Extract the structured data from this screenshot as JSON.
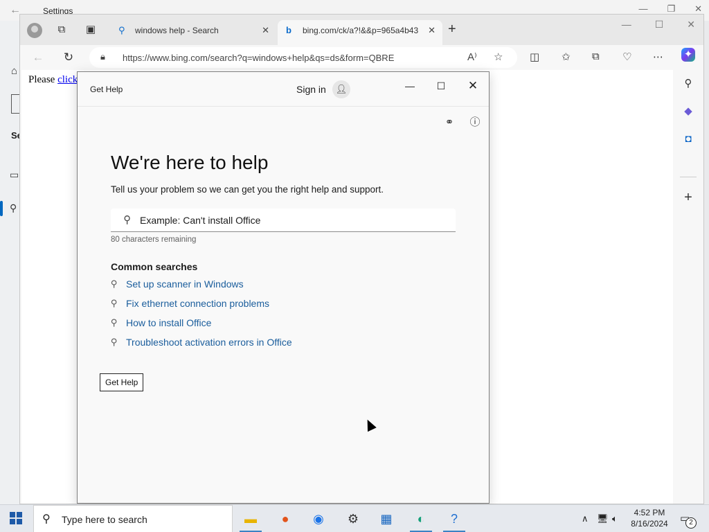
{
  "settings": {
    "title": "Settings",
    "heading_fragment": "Se"
  },
  "browser": {
    "tabs": [
      {
        "label": "windows help - Search",
        "favicon": "search-icon"
      },
      {
        "label": "bing.com/ck/a?!&&p=965a4b43",
        "favicon": "bing-icon"
      }
    ],
    "address": "https://www.bing.com/search?q=windows+help&qs=ds&form=QBRE",
    "page_text": "Please ",
    "page_link": "click"
  },
  "dialog": {
    "app_title": "Get Help",
    "sign_in": "Sign in",
    "heading": "We're here to help",
    "subheading": "Tell us your problem so we can get you the right help and support.",
    "search_placeholder": "Example: Can't install Office",
    "remaining": "80 characters remaining",
    "common_title": "Common searches",
    "common_searches": [
      "Set up scanner in Windows",
      "Fix ethernet connection problems",
      "How to install Office",
      "Troubleshoot activation errors in Office"
    ],
    "button_label": "Get Help"
  },
  "taskbar": {
    "search_placeholder": "Type here to search",
    "time": "4:52 PM",
    "date": "8/16/2024",
    "notification_count": "2"
  }
}
